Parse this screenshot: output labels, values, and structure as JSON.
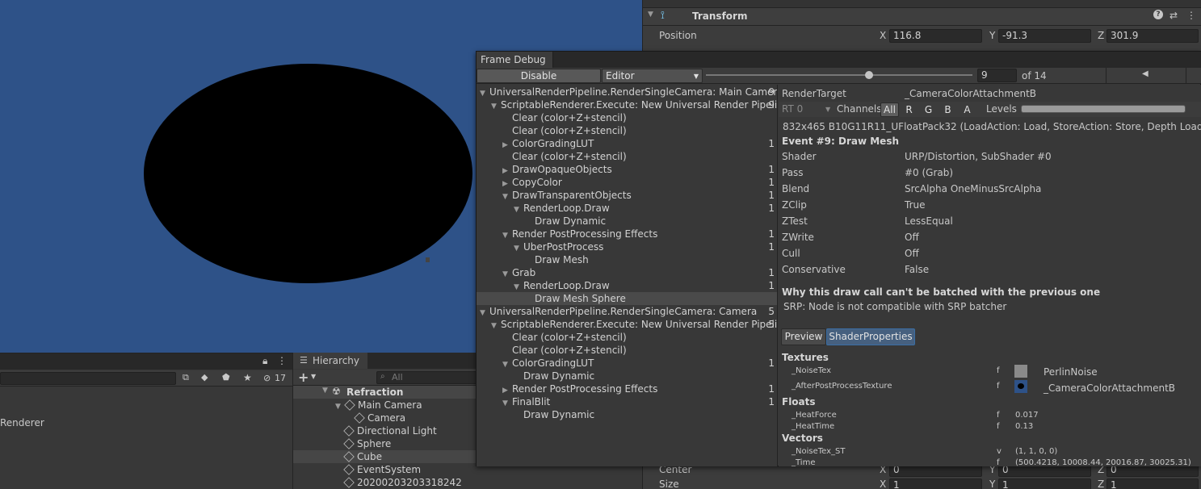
{
  "inspector": {
    "component_title": "Transform",
    "position_label": "Position",
    "pos_x_label": "X",
    "pos_x": "116.8",
    "pos_y_label": "Y",
    "pos_y": "-91.3",
    "pos_z_label": "Z",
    "pos_z": "301.9",
    "center_label": "Center",
    "center_x_label": "X",
    "center_x": "0",
    "center_y_label": "Y",
    "center_y": "0",
    "center_z_label": "Z",
    "center_z": "0",
    "size_label": "Size",
    "size_x_label": "X",
    "size_x": "1",
    "size_y_label": "Y",
    "size_y": "1",
    "size_z_label": "Z",
    "size_z": "1",
    "help_icon": "?"
  },
  "project": {
    "partial_text": "Renderer",
    "hidden_count": "17"
  },
  "hierarchy": {
    "tab_label": "Hierarchy",
    "search_placeholder": "All",
    "add_label": "+",
    "items": [
      {
        "label": "Refraction"
      },
      {
        "label": "Main Camera"
      },
      {
        "label": "Camera"
      },
      {
        "label": "Directional Light"
      },
      {
        "label": "Sphere"
      },
      {
        "label": "Cube"
      },
      {
        "label": "EventSystem"
      },
      {
        "label": "20200203203318242"
      }
    ]
  },
  "frame_debug": {
    "tab_label": "Frame Debug",
    "disable_label": "Disable",
    "target_select": "Editor",
    "event_index": "9",
    "event_total": "of 14",
    "tree": [
      {
        "label": "UniversalRenderPipeline.RenderSingleCamera: Main Camera",
        "count": "9"
      },
      {
        "label": "ScriptableRenderer.Execute: New Universal Render Pipeline",
        "count": "9"
      },
      {
        "label": "Clear (color+Z+stencil)",
        "count": ""
      },
      {
        "label": "Clear (color+Z+stencil)",
        "count": ""
      },
      {
        "label": "ColorGradingLUT",
        "count": "1"
      },
      {
        "label": "Clear (color+Z+stencil)",
        "count": ""
      },
      {
        "label": "DrawOpaqueObjects",
        "count": "1"
      },
      {
        "label": "CopyColor",
        "count": "1"
      },
      {
        "label": "DrawTransparentObjects",
        "count": "1"
      },
      {
        "label": "RenderLoop.Draw",
        "count": "1"
      },
      {
        "label": "Draw Dynamic",
        "count": ""
      },
      {
        "label": "Render PostProcessing Effects",
        "count": "1"
      },
      {
        "label": "UberPostProcess",
        "count": "1"
      },
      {
        "label": "Draw Mesh",
        "count": ""
      },
      {
        "label": "Grab",
        "count": "1"
      },
      {
        "label": "RenderLoop.Draw",
        "count": "1"
      },
      {
        "label": "Draw Mesh Sphere",
        "count": ""
      },
      {
        "label": "UniversalRenderPipeline.RenderSingleCamera: Camera",
        "count": "5"
      },
      {
        "label": "ScriptableRenderer.Execute: New Universal Render Pipeline",
        "count": "5"
      },
      {
        "label": "Clear (color+Z+stencil)",
        "count": ""
      },
      {
        "label": "Clear (color+Z+stencil)",
        "count": ""
      },
      {
        "label": "ColorGradingLUT",
        "count": "1"
      },
      {
        "label": "Draw Dynamic",
        "count": ""
      },
      {
        "label": "Render PostProcessing Effects",
        "count": "1"
      },
      {
        "label": "FinalBlit",
        "count": "1"
      },
      {
        "label": "Draw Dynamic",
        "count": ""
      }
    ],
    "render_target_label": "RenderTarget",
    "render_target_value": "_CameraColorAttachmentB",
    "rt_select": "RT 0",
    "channels_label": "Channels",
    "ch_all": "All",
    "ch_r": "R",
    "ch_g": "G",
    "ch_b": "B",
    "ch_a": "A",
    "levels_label": "Levels",
    "format_line": "832x465 B10G11R11_UFloatPack32 (LoadAction: Load, StoreAction: Store, Depth LoadAction",
    "event_title": "Event #9: Draw Mesh",
    "props": [
      {
        "key": "Shader",
        "value": "URP/Distortion, SubShader #0"
      },
      {
        "key": "Pass",
        "value": "#0 (Grab)"
      },
      {
        "key": "Blend",
        "value": "SrcAlpha OneMinusSrcAlpha"
      },
      {
        "key": "ZClip",
        "value": "True"
      },
      {
        "key": "ZTest",
        "value": "LessEqual"
      },
      {
        "key": "ZWrite",
        "value": "Off"
      },
      {
        "key": "Cull",
        "value": "Off"
      },
      {
        "key": "Conservative",
        "value": "False"
      }
    ],
    "batch_title": "Why this draw call can't be batched with the previous one",
    "batch_reason": "SRP: Node is not compatible with SRP batcher",
    "tab_preview": "Preview",
    "tab_shader_props": "ShaderProperties",
    "textures_header": "Textures",
    "textures": [
      {
        "name": "_NoiseTex",
        "flag": "f",
        "value": "PerlinNoise"
      },
      {
        "name": "_AfterPostProcessTexture",
        "flag": "f",
        "value": "_CameraColorAttachmentB"
      }
    ],
    "floats_header": "Floats",
    "floats": [
      {
        "name": "_HeatForce",
        "flag": "f",
        "value": "0.017"
      },
      {
        "name": "_HeatTime",
        "flag": "f",
        "value": "0.13"
      }
    ],
    "vectors_header": "Vectors",
    "vectors": [
      {
        "name": "_NoiseTex_ST",
        "flag": "v",
        "value": "(1, 1, 0, 0)"
      },
      {
        "name": "_Time",
        "flag": "f",
        "value": "(500.4218, 10008.44, 20016.87, 30025.31)"
      }
    ]
  }
}
